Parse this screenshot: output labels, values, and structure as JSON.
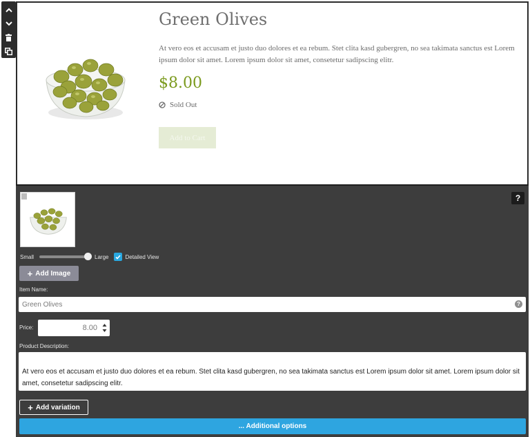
{
  "toolbar": {
    "icons": [
      "chevron-up-icon",
      "chevron-down-icon",
      "trash-icon",
      "duplicate-icon"
    ]
  },
  "product": {
    "title": "Green Olives",
    "description": "At vero eos et accusam et justo duo dolores et ea rebum. Stet clita kasd gubergren, no sea takimata sanctus est Lorem ipsum dolor sit amet. Lorem ipsum dolor sit amet, consetetur sadipscing elitr.",
    "price": "$8.00",
    "status": "Sold Out",
    "add_to_cart_label": "Add to Cart",
    "price_color": "#7b9a1e"
  },
  "editor": {
    "help_label": "?",
    "image_size": {
      "small_label": "Small",
      "large_label": "Large",
      "level": 1.0
    },
    "detailed_view_label": "Detailed View",
    "detailed_view_checked": true,
    "add_image_label": "Add Image",
    "item_name_label": "Item Name:",
    "item_name_value": "Green Olives",
    "price_label": "Price:",
    "price_value": "8.00",
    "product_description_label": "Product Description:",
    "product_description_value": "At vero eos et accusam et justo duo dolores et ea rebum. Stet clita kasd gubergren, no sea takimata sanctus est Lorem ipsum dolor sit amet. Lorem ipsum dolor sit amet, consetetur sadipscing elitr.",
    "add_variation_label": "Add variation",
    "additional_options_label": "... Additional options",
    "accent_color": "#2ea5e0"
  }
}
